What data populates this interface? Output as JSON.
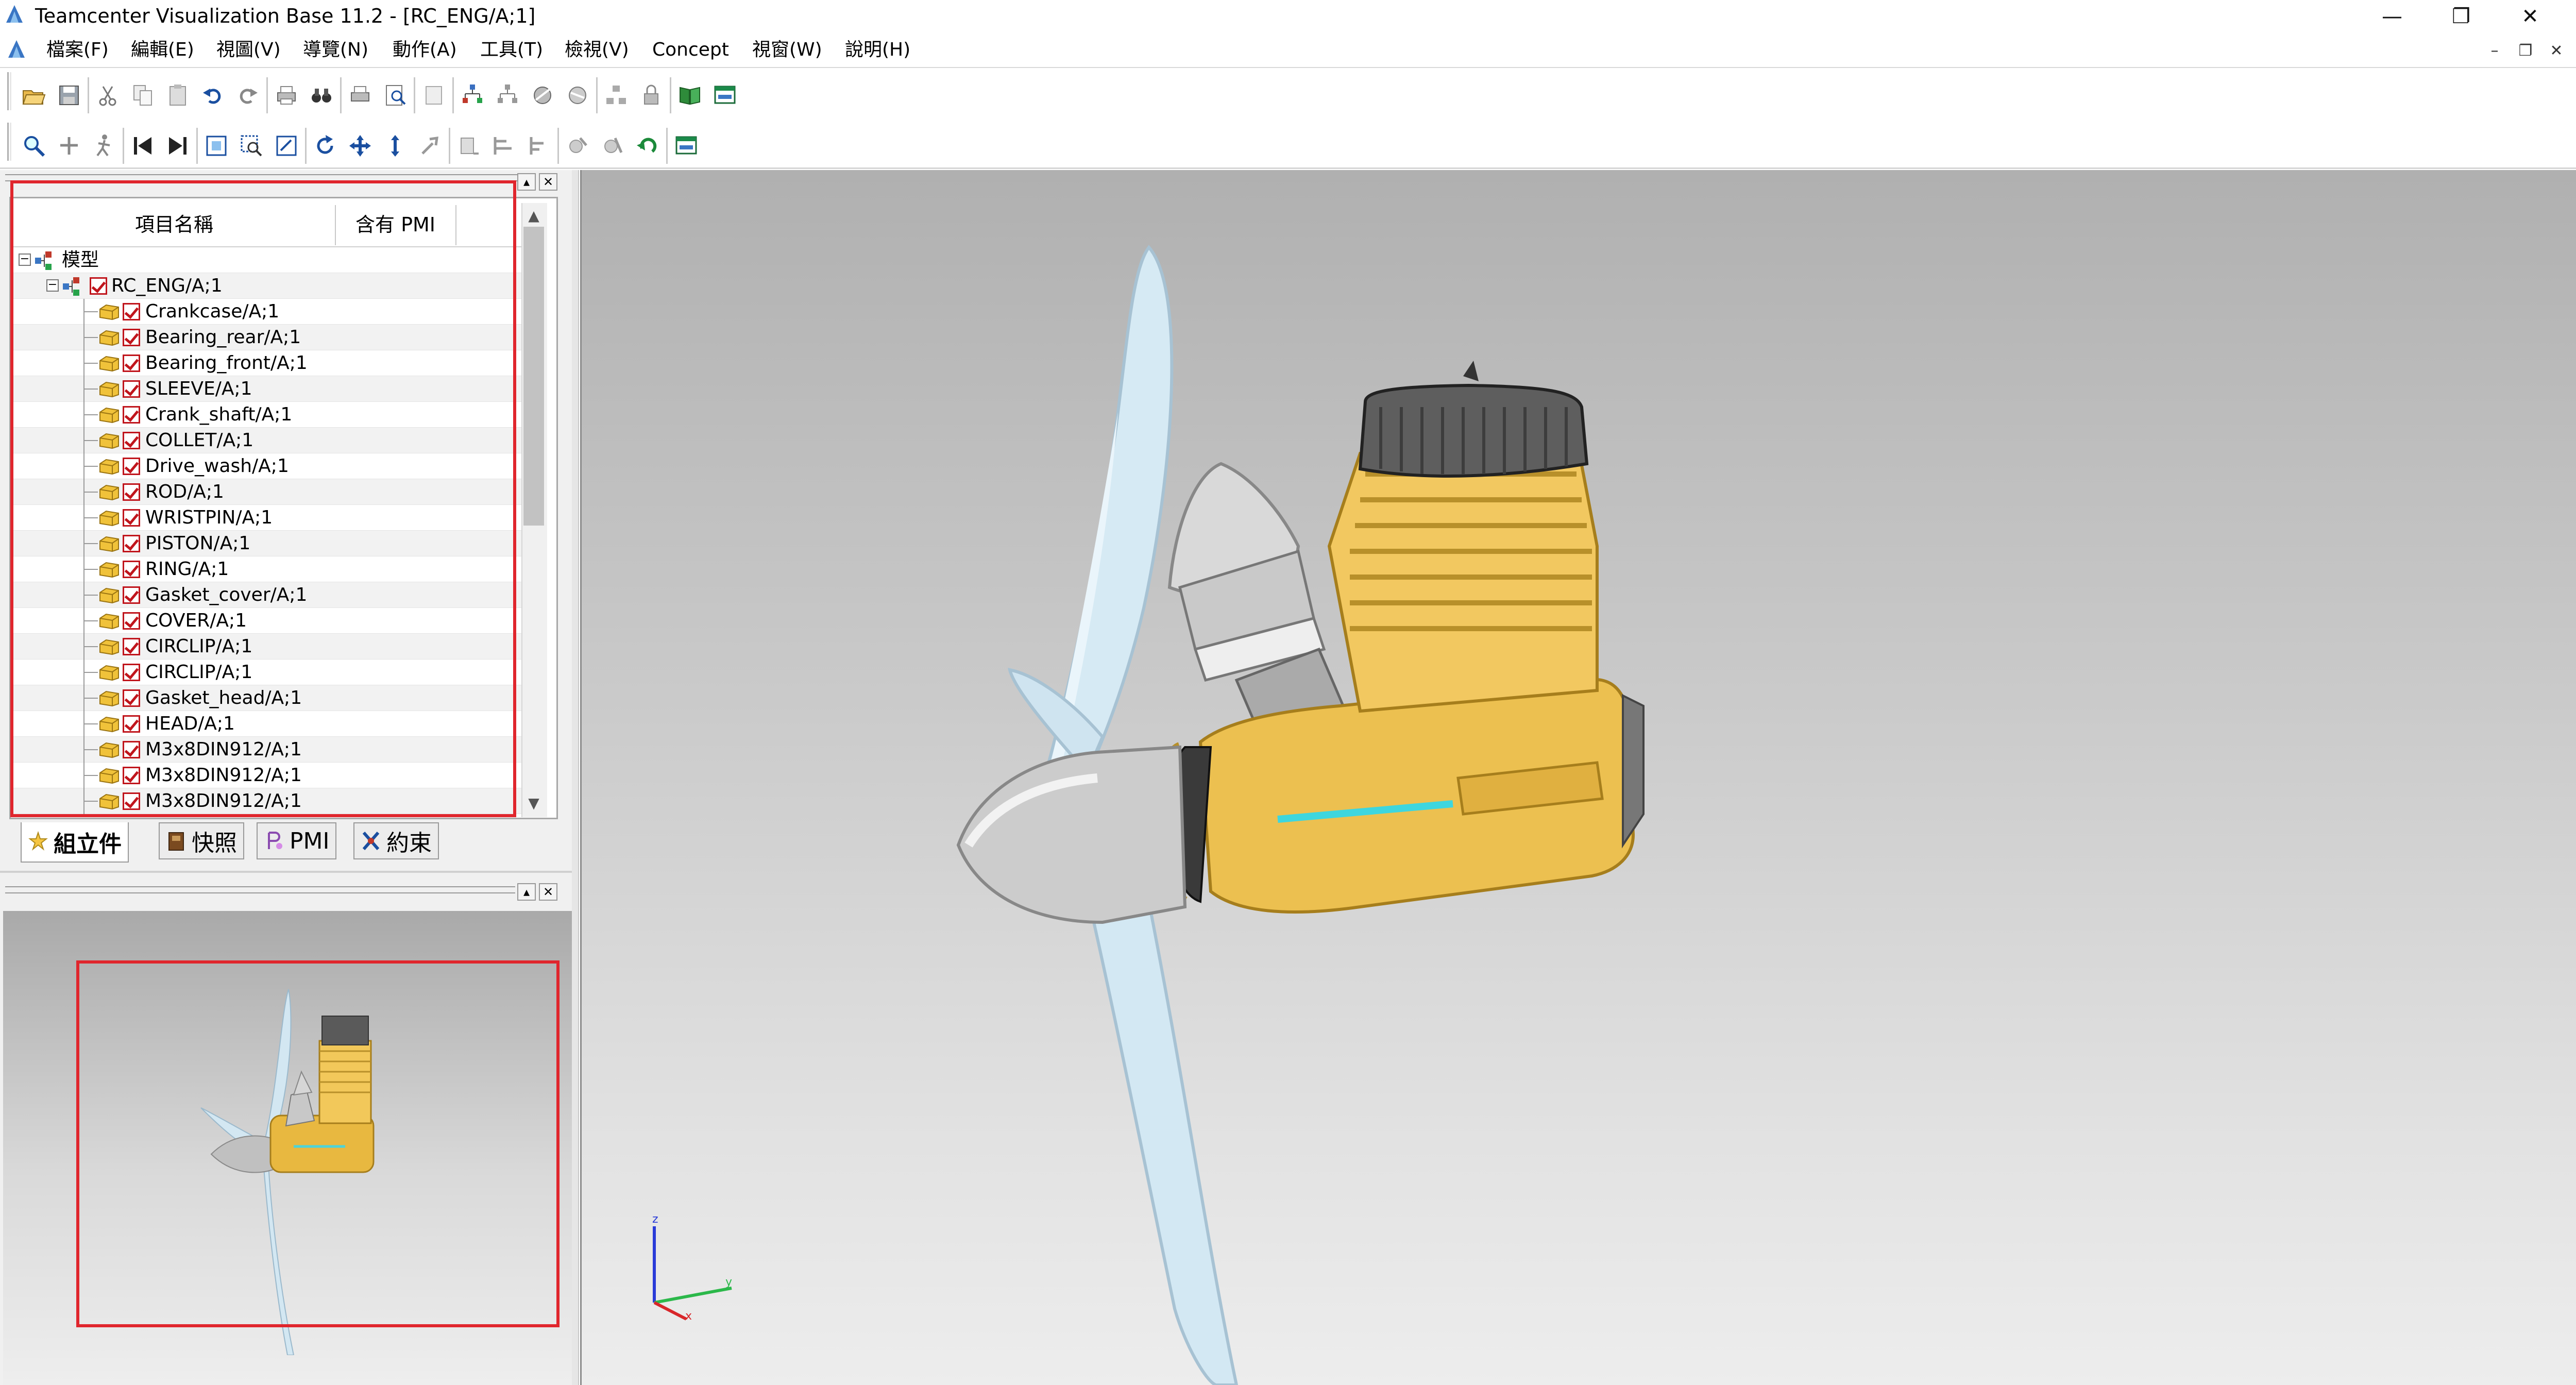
{
  "window": {
    "title": "Teamcenter Visualization Base 11.2 - [RC_ENG/A;1]",
    "controls": {
      "minimize": "—",
      "restore": "❐",
      "close": "✕"
    },
    "mdi_controls": {
      "minimize": "–",
      "restore": "❐",
      "close": "✕"
    }
  },
  "menu": {
    "items": [
      "檔案(F)",
      "編輯(E)",
      "視圖(V)",
      "導覽(N)",
      "動作(A)",
      "工具(T)",
      "檢視(V)",
      "Concept",
      "視窗(W)",
      "說明(H)"
    ]
  },
  "toolbars": {
    "row1_icons": [
      "open-icon",
      "save-icon",
      "cut-icon",
      "copy-icon",
      "paste-icon",
      "undo-icon",
      "redo-icon",
      "print-icon",
      "print-preview-icon",
      "binoculars-icon",
      "print-setup-icon",
      "zoom-page-icon",
      "page-icon",
      "assembly-tree-icon",
      "assembly-tree-2-icon",
      "section-icon",
      "section-2-icon",
      "structure-icon",
      "lock-icon",
      "book-icon",
      "window-icon"
    ],
    "row2_icons": [
      "zoom-icon",
      "pan-fly-icon",
      "walk-icon",
      "first-view-icon",
      "last-view-icon",
      "fit-all-icon",
      "zoom-box-icon",
      "zoom-selection-icon",
      "rotate-icon",
      "pan-icon",
      "zoom-vertical-icon",
      "orient-icon",
      "measure-icon",
      "align-icon",
      "distribute-icon",
      "part-select-icon",
      "part-hide-icon",
      "refresh-icon",
      "display-icon"
    ]
  },
  "tree": {
    "headers": {
      "name": "項目名稱",
      "pmi": "含有 PMI"
    },
    "root": "模型",
    "assembly": "RC_ENG/A;1",
    "parts": [
      "Crankcase/A;1",
      "Bearing_rear/A;1",
      "Bearing_front/A;1",
      "SLEEVE/A;1",
      "Crank_shaft/A;1",
      "COLLET/A;1",
      "Drive_wash/A;1",
      "ROD/A;1",
      "WRISTPIN/A;1",
      "PISTON/A;1",
      "RING/A;1",
      "Gasket_cover/A;1",
      "COVER/A;1",
      "CIRCLIP/A;1",
      "CIRCLIP/A;1",
      "Gasket_head/A;1",
      "HEAD/A;1",
      "M3x8DIN912/A;1",
      "M3x8DIN912/A;1",
      "M3x8DIN912/A;1"
    ]
  },
  "tabs": [
    {
      "label": "組立件",
      "icon": "assembly-tab-icon",
      "active": true
    },
    {
      "label": "快照",
      "icon": "snapshot-tab-icon",
      "active": false
    },
    {
      "label": "PMI",
      "icon": "pmi-tab-icon",
      "active": false
    },
    {
      "label": "約束",
      "icon": "constraint-tab-icon",
      "active": false
    }
  ],
  "triad": {
    "z": "z",
    "y": "y",
    "x": "x"
  },
  "colors": {
    "highlight_red": "#e0262d",
    "engine_gold": "#f0c050",
    "propeller": "#d7ebf5",
    "head_gray": "#5c5c5c"
  }
}
